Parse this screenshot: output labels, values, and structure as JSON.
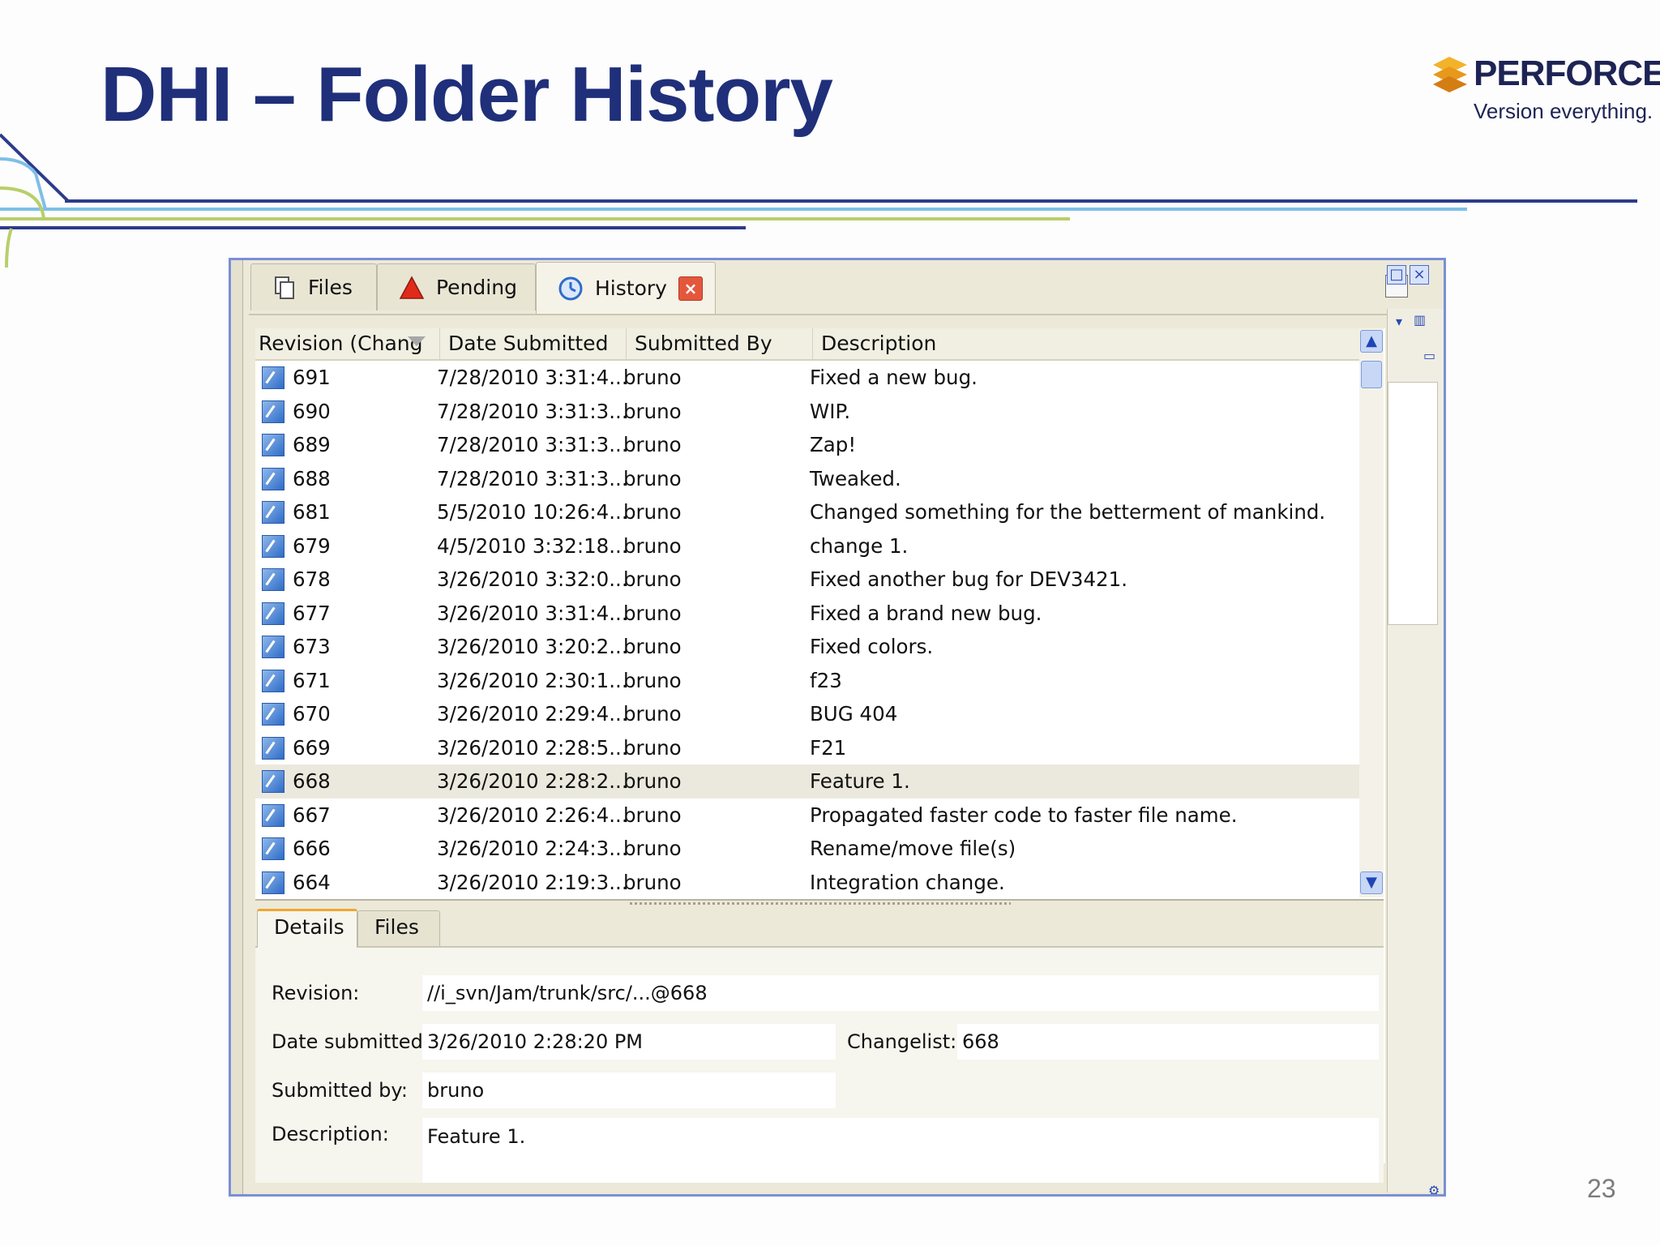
{
  "slide": {
    "title": "DHI – Folder History",
    "page_number": "23",
    "logo": {
      "name": "PERFORCE",
      "tagline": "Version everything."
    }
  },
  "colors": {
    "title": "#1f2f7a",
    "accent_orange": "#f0a531",
    "tab_close": "#e4573c",
    "window_border": "#7b8fd6"
  },
  "tabs": [
    {
      "label": "Files",
      "icon": "files-icon"
    },
    {
      "label": "Pending",
      "icon": "warning-icon"
    },
    {
      "label": "History",
      "icon": "history-clock-icon",
      "active": true,
      "close_icon": "close-icon"
    }
  ],
  "table": {
    "columns": [
      "Revision (Chang",
      "Date Submitted",
      "Submitted By",
      "Description"
    ],
    "rows": [
      {
        "rev": "691",
        "date": "7/28/2010 3:31:4...",
        "user": "bruno",
        "desc": "Fixed a new bug."
      },
      {
        "rev": "690",
        "date": "7/28/2010 3:31:3...",
        "user": "bruno",
        "desc": "WIP."
      },
      {
        "rev": "689",
        "date": "7/28/2010 3:31:3...",
        "user": "bruno",
        "desc": "Zap!"
      },
      {
        "rev": "688",
        "date": "7/28/2010 3:31:3...",
        "user": "bruno",
        "desc": "Tweaked."
      },
      {
        "rev": "681",
        "date": "5/5/2010 10:26:4...",
        "user": "bruno",
        "desc": "Changed something for the betterment of mankind."
      },
      {
        "rev": "679",
        "date": "4/5/2010 3:32:18...",
        "user": "bruno",
        "desc": "change 1."
      },
      {
        "rev": "678",
        "date": "3/26/2010 3:32:0...",
        "user": "bruno",
        "desc": "Fixed another bug for DEV3421."
      },
      {
        "rev": "677",
        "date": "3/26/2010 3:31:4...",
        "user": "bruno",
        "desc": "Fixed a brand new bug."
      },
      {
        "rev": "673",
        "date": "3/26/2010 3:20:2...",
        "user": "bruno",
        "desc": "Fixed colors."
      },
      {
        "rev": "671",
        "date": "3/26/2010 2:30:1...",
        "user": "bruno",
        "desc": "f23"
      },
      {
        "rev": "670",
        "date": "3/26/2010 2:29:4...",
        "user": "bruno",
        "desc": "BUG 404"
      },
      {
        "rev": "669",
        "date": "3/26/2010 2:28:5...",
        "user": "bruno",
        "desc": "F21"
      },
      {
        "rev": "668",
        "date": "3/26/2010 2:28:2...",
        "user": "bruno",
        "desc": "Feature 1.",
        "selected": true
      },
      {
        "rev": "667",
        "date": "3/26/2010 2:26:4...",
        "user": "bruno",
        "desc": "Propagated faster code to faster file name."
      },
      {
        "rev": "666",
        "date": "3/26/2010 2:24:3...",
        "user": "bruno",
        "desc": "Rename/move file(s)"
      },
      {
        "rev": "664",
        "date": "3/26/2010 2:19:3...",
        "user": "bruno",
        "desc": "Integration change."
      }
    ]
  },
  "details": {
    "tabs": [
      "Details",
      "Files"
    ],
    "revision_label": "Revision:",
    "revision_value": "//i_svn/Jam/trunk/src/...@668",
    "date_label": "Date submitted:",
    "date_value": "3/26/2010 2:28:20 PM",
    "changelist_label": "Changelist:",
    "changelist_value": "668",
    "submitted_by_label": "Submitted by:",
    "submitted_by_value": "bruno",
    "description_label": "Description:",
    "description_value": "Feature 1."
  }
}
